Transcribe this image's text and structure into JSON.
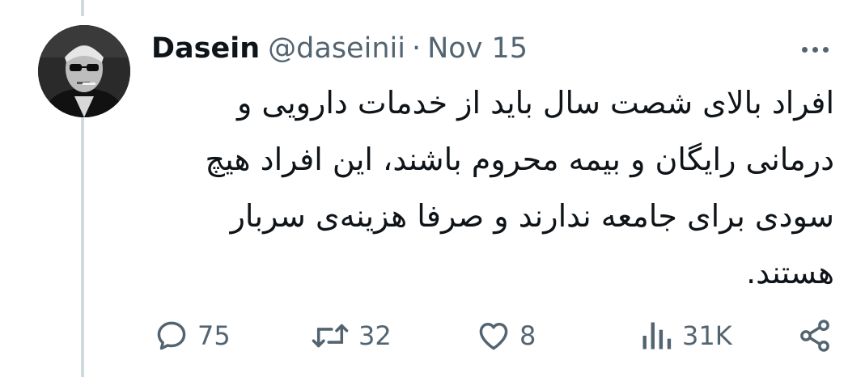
{
  "author": {
    "display_name": "Dasein",
    "handle": "@daseinii",
    "separator": "·",
    "date": "Nov 15",
    "avatar_icon": "avatar-photo"
  },
  "tweet": {
    "lines": [
      "افراد بالای شصت سال باید از خدمات دارویی و",
      "درمانی رایگان و بیمه محروم باشند، این افراد هیچ",
      "سودی برای جامعه ندارند و صرفا هزینه‌ی سربار",
      "هستند."
    ]
  },
  "actions": {
    "replies": "75",
    "retweets": "32",
    "likes": "8",
    "views": "31K"
  },
  "icons": {
    "reply": "speech-bubble-icon",
    "retweet": "retweet-arrows-icon",
    "like": "heart-icon",
    "views": "bar-chart-icon",
    "share": "share-icon",
    "more": "more-dots-icon"
  },
  "colors": {
    "text_primary": "#0f1419",
    "text_secondary": "#536471",
    "thread_line": "#cfd9de"
  }
}
